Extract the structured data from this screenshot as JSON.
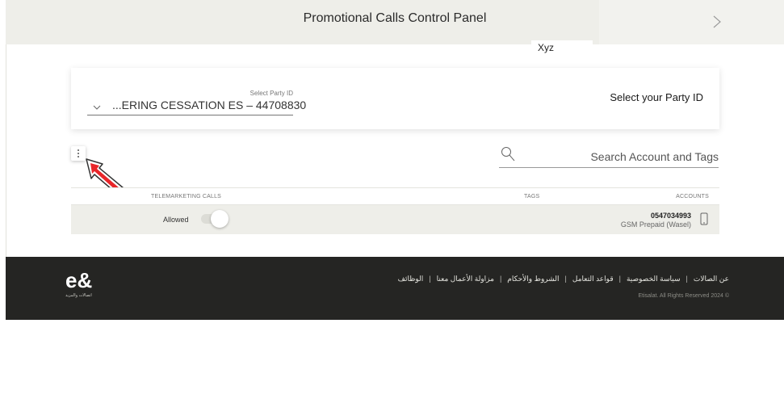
{
  "header": {
    "title": "Promotional Calls Control Panel",
    "chevron_icon": "chevron-right-icon"
  },
  "floating_tag": "Xyz",
  "party": {
    "select_label": "Select Party ID",
    "select_value": "...ERING CESSATION ES – 44708830",
    "title": "Select your Party ID"
  },
  "search": {
    "placeholder": "Search Account and Tags"
  },
  "table": {
    "columns": [
      "TELEMARKETING CALLS",
      "TAGS",
      "ACCOUNTS"
    ],
    "rows": [
      {
        "status_label": "Allowed",
        "toggle_on": false,
        "tags": "",
        "account_number": "0547034993",
        "account_type": "GSM Prepaid (Wasel)"
      }
    ]
  },
  "footer": {
    "links": [
      "عن الصالات",
      "سياسة الخصوصية",
      "قواعد التعامل",
      "الشروط والأحكام",
      "مزاولة الأعمال معنا",
      "الوظائف"
    ],
    "copyright": "Etisalat. All Rights Reserved 2024 ©",
    "logo_text": "e&",
    "logo_sub": "اتصالات والمزيد"
  },
  "colors": {
    "header_bg": "#eeeee9",
    "row_bg": "#eeeee9",
    "footer_bg": "#252523",
    "cursor_red": "#e8262a"
  }
}
